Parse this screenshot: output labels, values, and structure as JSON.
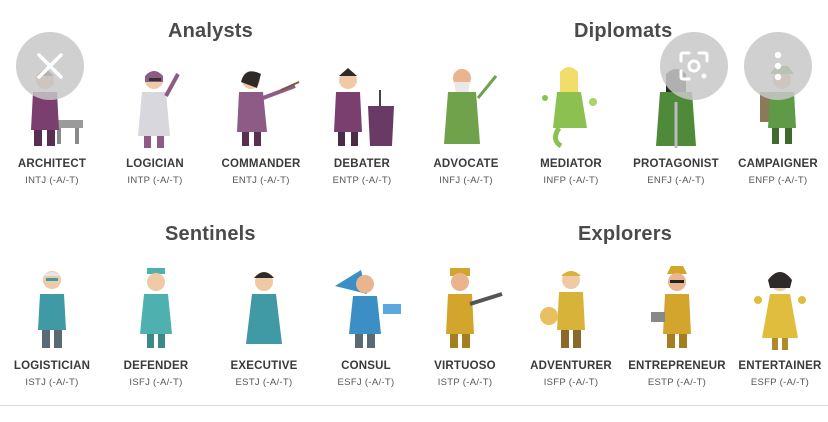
{
  "groups": [
    {
      "title": "Analysts",
      "types": [
        {
          "name": "ARCHITECT",
          "code": "INTJ (-A/-T)",
          "color": "#7a3f6e"
        },
        {
          "name": "LOGICIAN",
          "code": "INTP (-A/-T)",
          "color": "#8e5a86"
        },
        {
          "name": "COMMANDER",
          "code": "ENTJ (-A/-T)",
          "color": "#7a3f6e"
        },
        {
          "name": "DEBATER",
          "code": "ENTP (-A/-T)",
          "color": "#8e5a86"
        }
      ]
    },
    {
      "title": "Diplomats",
      "types": [
        {
          "name": "ADVOCATE",
          "code": "INFJ (-A/-T)",
          "color": "#6fa24a"
        },
        {
          "name": "MEDIATOR",
          "code": "INFP (-A/-T)",
          "color": "#8cc152"
        },
        {
          "name": "PROTAGONIST",
          "code": "ENFJ (-A/-T)",
          "color": "#4f8a3a"
        },
        {
          "name": "CAMPAIGNER",
          "code": "ENFP (-A/-T)",
          "color": "#5f9a46"
        }
      ]
    },
    {
      "title": "Sentinels",
      "types": [
        {
          "name": "LOGISTICIAN",
          "code": "ISTJ (-A/-T)",
          "color": "#3f9aa5"
        },
        {
          "name": "DEFENDER",
          "code": "ISFJ (-A/-T)",
          "color": "#4fb0b0"
        },
        {
          "name": "EXECUTIVE",
          "code": "ESTJ (-A/-T)",
          "color": "#3f9aa5"
        },
        {
          "name": "CONSUL",
          "code": "ESFJ (-A/-T)",
          "color": "#3b8fc4"
        }
      ]
    },
    {
      "title": "Explorers",
      "types": [
        {
          "name": "VIRTUOSO",
          "code": "ISTP (-A/-T)",
          "color": "#d4a52c"
        },
        {
          "name": "ADVENTURER",
          "code": "ISFP (-A/-T)",
          "color": "#d8b33a"
        },
        {
          "name": "ENTREPRENEUR",
          "code": "ESTP (-A/-T)",
          "color": "#d4a52c"
        },
        {
          "name": "ENTERTAINER",
          "code": "ESFP (-A/-T)",
          "color": "#e0bd3c"
        }
      ]
    }
  ],
  "overlay_buttons": [
    {
      "icon": "close-icon"
    },
    {
      "icon": "lens-scan-icon"
    },
    {
      "icon": "more-vertical-icon"
    }
  ]
}
